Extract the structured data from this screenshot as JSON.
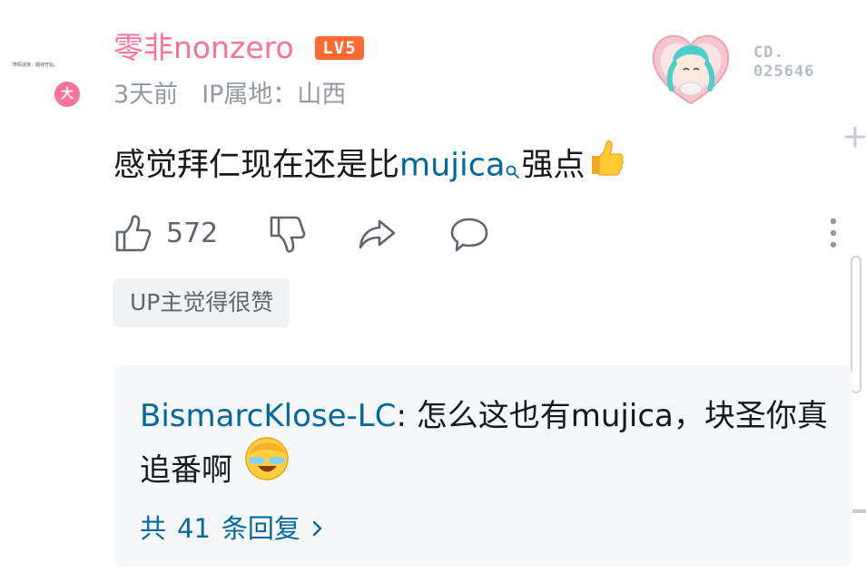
{
  "comment": {
    "avatar_note": "寒假进度，期待开始。",
    "vip_badge": "大",
    "username": "零非nonzero",
    "level": "LV5",
    "time": "3天前",
    "ip": "IP属地：山西",
    "pendant_code_line1": "CD.",
    "pendant_code_line2": "025646",
    "content_before": "感觉拜仁现在还是比",
    "content_link": "mujica",
    "content_after": "强点",
    "like_count": "572",
    "up_tag": "UP主觉得很赞"
  },
  "sub_reply": {
    "username": "BismarcKlose-LC",
    "separator": ": ",
    "text": "怎么这也有mujica，块圣你真追番啊",
    "more_prefix": "共",
    "more_count": "41",
    "more_suffix": "条回复"
  },
  "icons": {
    "like": "thumbs-up-icon",
    "dislike": "thumbs-down-icon",
    "share": "share-icon",
    "reply": "reply-bubble-icon",
    "more": "more-vertical-icon"
  },
  "colors": {
    "username_pink": "#fb7299",
    "link_blue": "#00699d",
    "meta_gray": "#9499a0",
    "level_orange": "#ff6a33"
  }
}
